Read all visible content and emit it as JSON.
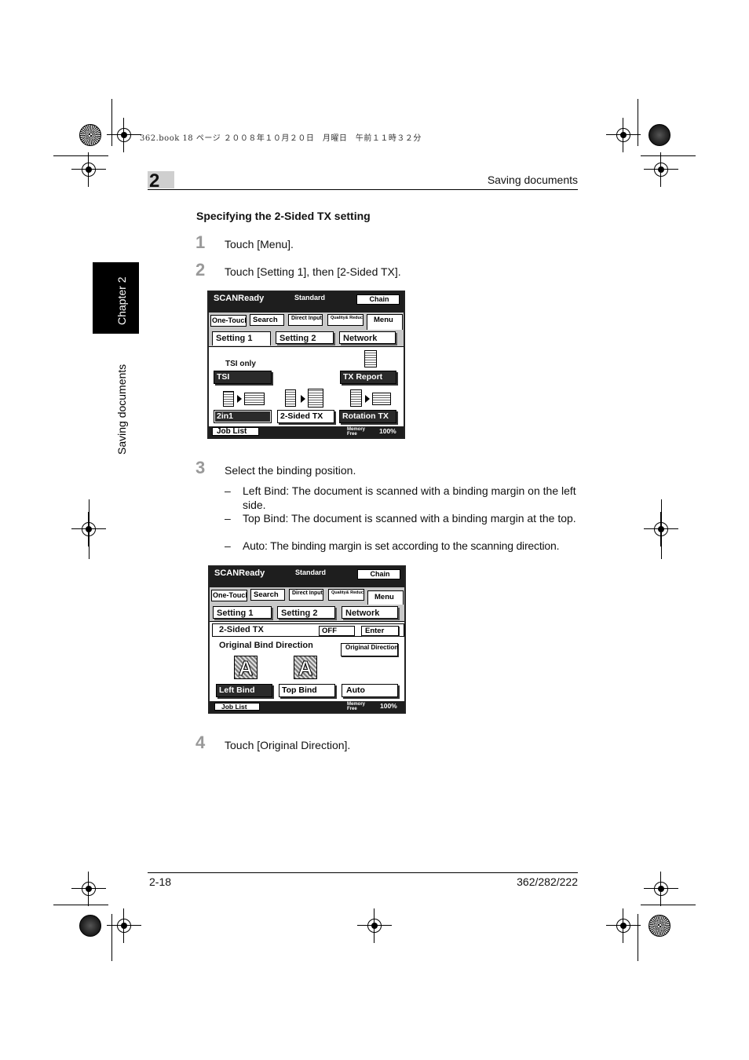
{
  "print_header": "362.book  18 ページ  ２００８年１０月２０日　月曜日　午前１１時３２分",
  "chapter": {
    "number": "2",
    "running_title": "Saving documents",
    "side_tab_label": "Chapter 2",
    "side_title": "Saving documents"
  },
  "section_title": "Specifying the 2-Sided TX setting",
  "steps": [
    {
      "num": "1",
      "text": "Touch [Menu]."
    },
    {
      "num": "2",
      "text": "Touch [Setting 1], then [2-Sided TX]."
    },
    {
      "num": "3",
      "text": "Select the binding position."
    },
    {
      "num": "4",
      "text": "Touch [Original Direction]."
    }
  ],
  "bullets": [
    {
      "dash": "–",
      "text": "Left Bind: The document is scanned with a binding margin on the left side."
    },
    {
      "dash": "–",
      "text": "Top Bind: The document is scanned with a binding margin at the top."
    },
    {
      "dash": "–",
      "text": "Auto: The binding margin is set according to the scanning direction."
    }
  ],
  "screen1": {
    "status": "SCANReady",
    "mode": "Standard",
    "chain": "Chain",
    "nav": [
      "One-Touch",
      "Search",
      "Direct Input",
      "Quality& Reduction",
      "Menu"
    ],
    "tabs": [
      "Setting 1",
      "Setting 2",
      "Network"
    ],
    "tsi_only": "TSI only",
    "tsi": "TSI",
    "tx_report": "TX Report",
    "twoin1": "2in1",
    "two_sided": "2-Sided TX",
    "rotation": "Rotation TX",
    "job_list": "Job List",
    "memory": "Memory",
    "free": "Free",
    "percent": "100%"
  },
  "screen2": {
    "status": "SCANReady",
    "mode": "Standard",
    "chain": "Chain",
    "nav": [
      "One-Touch",
      "Search",
      "Direct Input",
      "Quality& Reduction",
      "Menu"
    ],
    "tabs": [
      "Setting 1",
      "Setting 2",
      "Network"
    ],
    "panel_title": "2-Sided TX",
    "off": "OFF",
    "enter": "Enter",
    "bind_label": "Original Bind Direction",
    "orig_dir": "Original Direction",
    "letter": "A",
    "left_bind": "Left Bind",
    "top_bind": "Top Bind",
    "auto": "Auto",
    "job_list": "Job List",
    "memory": "Memory",
    "free": "Free",
    "percent": "100%"
  },
  "footer": {
    "page": "2-18",
    "models": "362/282/222"
  }
}
